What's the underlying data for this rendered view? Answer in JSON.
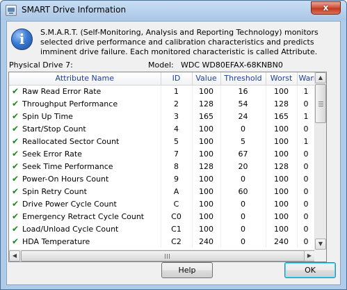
{
  "window": {
    "title": "SMART Drive Information",
    "close_label": "x"
  },
  "info": {
    "description": "S.M.A.R.T. (Self-Monitoring, Analysis and Reporting Technology) monitors selected drive performance and calibration characteristics and predicts imminent drive failure. Each monitored characteristic is called Attribute."
  },
  "drive": {
    "physical_label": "Physical Drive 7:",
    "model_label": "Model:",
    "model_value": "WDC WD80EFAX-68KNBN0"
  },
  "table": {
    "columns": [
      "Attribute Name",
      "ID",
      "Value",
      "Threshold",
      "Worst",
      "Warranty"
    ],
    "rows": [
      {
        "name": "Raw Read Error Rate",
        "id": "1",
        "value": "100",
        "threshold": "16",
        "worst": "100",
        "warranty": "1"
      },
      {
        "name": "Throughput Performance",
        "id": "2",
        "value": "128",
        "threshold": "54",
        "worst": "128",
        "warranty": "0"
      },
      {
        "name": "Spin Up Time",
        "id": "3",
        "value": "165",
        "threshold": "24",
        "worst": "165",
        "warranty": "1"
      },
      {
        "name": "Start/Stop Count",
        "id": "4",
        "value": "100",
        "threshold": "0",
        "worst": "100",
        "warranty": "0"
      },
      {
        "name": "Reallocated Sector Count",
        "id": "5",
        "value": "100",
        "threshold": "5",
        "worst": "100",
        "warranty": "1"
      },
      {
        "name": "Seek Error Rate",
        "id": "7",
        "value": "100",
        "threshold": "67",
        "worst": "100",
        "warranty": "0"
      },
      {
        "name": "Seek Time Performance",
        "id": "8",
        "value": "128",
        "threshold": "20",
        "worst": "128",
        "warranty": "0"
      },
      {
        "name": "Power-On Hours Count",
        "id": "9",
        "value": "100",
        "threshold": "0",
        "worst": "100",
        "warranty": "0"
      },
      {
        "name": "Spin Retry Count",
        "id": "A",
        "value": "100",
        "threshold": "60",
        "worst": "100",
        "warranty": "0"
      },
      {
        "name": "Drive Power Cycle Count",
        "id": "C",
        "value": "100",
        "threshold": "0",
        "worst": "100",
        "warranty": "0"
      },
      {
        "name": "Emergency Retract Cycle Count",
        "id": "C0",
        "value": "100",
        "threshold": "0",
        "worst": "100",
        "warranty": "0"
      },
      {
        "name": "Load/Unload Cycle Count",
        "id": "C1",
        "value": "100",
        "threshold": "0",
        "worst": "100",
        "warranty": "0"
      },
      {
        "name": "HDA Temperature",
        "id": "C2",
        "value": "240",
        "threshold": "0",
        "worst": "240",
        "warranty": "0"
      }
    ]
  },
  "buttons": {
    "help": "Help",
    "ok": "OK"
  },
  "colors": {
    "header_text": "#1a3f9c",
    "ok_check": "#1a8a1a",
    "close_button": "#c23a1f"
  }
}
